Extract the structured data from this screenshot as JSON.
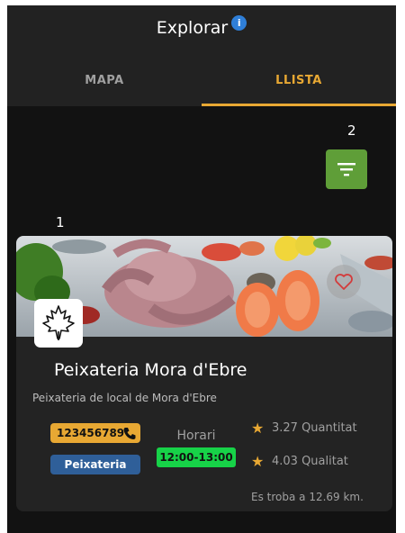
{
  "header": {
    "title": "Explorar",
    "info_icon": "info-icon"
  },
  "tabs": [
    {
      "label": "MAPA",
      "active": false
    },
    {
      "label": "LLISTA",
      "active": true
    }
  ],
  "annotations": {
    "filter_marker": "2",
    "card_marker": "1"
  },
  "filter_button": {
    "icon": "filter-icon"
  },
  "shop": {
    "name": "Peixateria Mora d'Ebre",
    "description": "Peixateria de local de Mora d'Ebre",
    "phone": "123456789",
    "category": "Peixateria",
    "schedule_label": "Horari",
    "schedule": "12:00-13:00",
    "quantity_rating": "3.27 Quantitat",
    "quality_rating": "4.03 Qualitat",
    "distance": "Es troba a 12.69 km."
  },
  "colors": {
    "accent": "#e8a833",
    "filter_green": "#5f9e38",
    "schedule_green": "#17d248",
    "category_blue": "#2f5f99",
    "background": "#121212",
    "card": "#232323"
  }
}
